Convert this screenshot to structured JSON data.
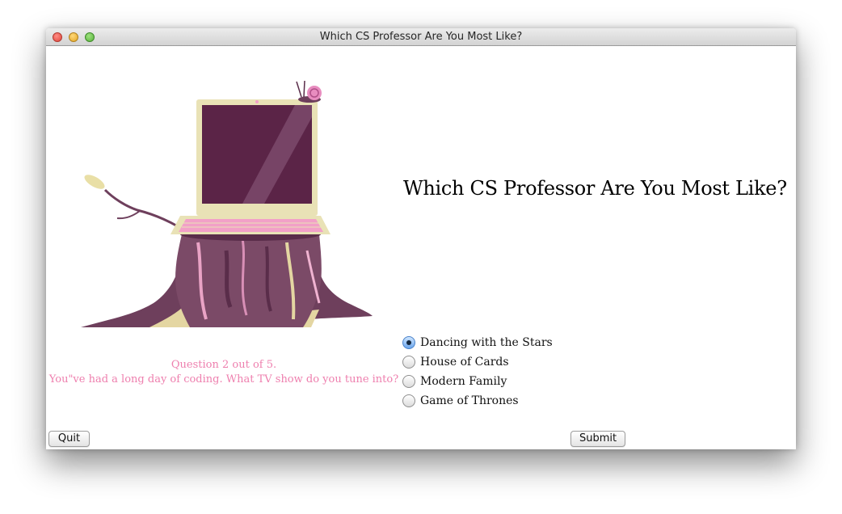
{
  "window": {
    "title": "Which CS Professor Are You Most Like?"
  },
  "main": {
    "heading": "Which CS Professor Are You Most Like?",
    "question_counter": "Question 2 out of 5.",
    "question_text": "You\"ve had a long day of coding.  What TV show do you tune into?",
    "options": [
      {
        "label": "Dancing with the Stars",
        "selected": true
      },
      {
        "label": "House of Cards",
        "selected": false
      },
      {
        "label": "Modern Family",
        "selected": false
      },
      {
        "label": "Game of Thrones",
        "selected": false
      }
    ],
    "illustration": "laptop-on-tree-stump-with-snail"
  },
  "buttons": {
    "quit_label": "Quit",
    "submit_label": "Submit"
  },
  "colors": {
    "question_text": "#ee7fae",
    "laptop_screen": "#5b2447",
    "stump": "#7b4a67",
    "accent_pink": "#f2a0c8",
    "laptop_frame": "#e9e2b6"
  }
}
